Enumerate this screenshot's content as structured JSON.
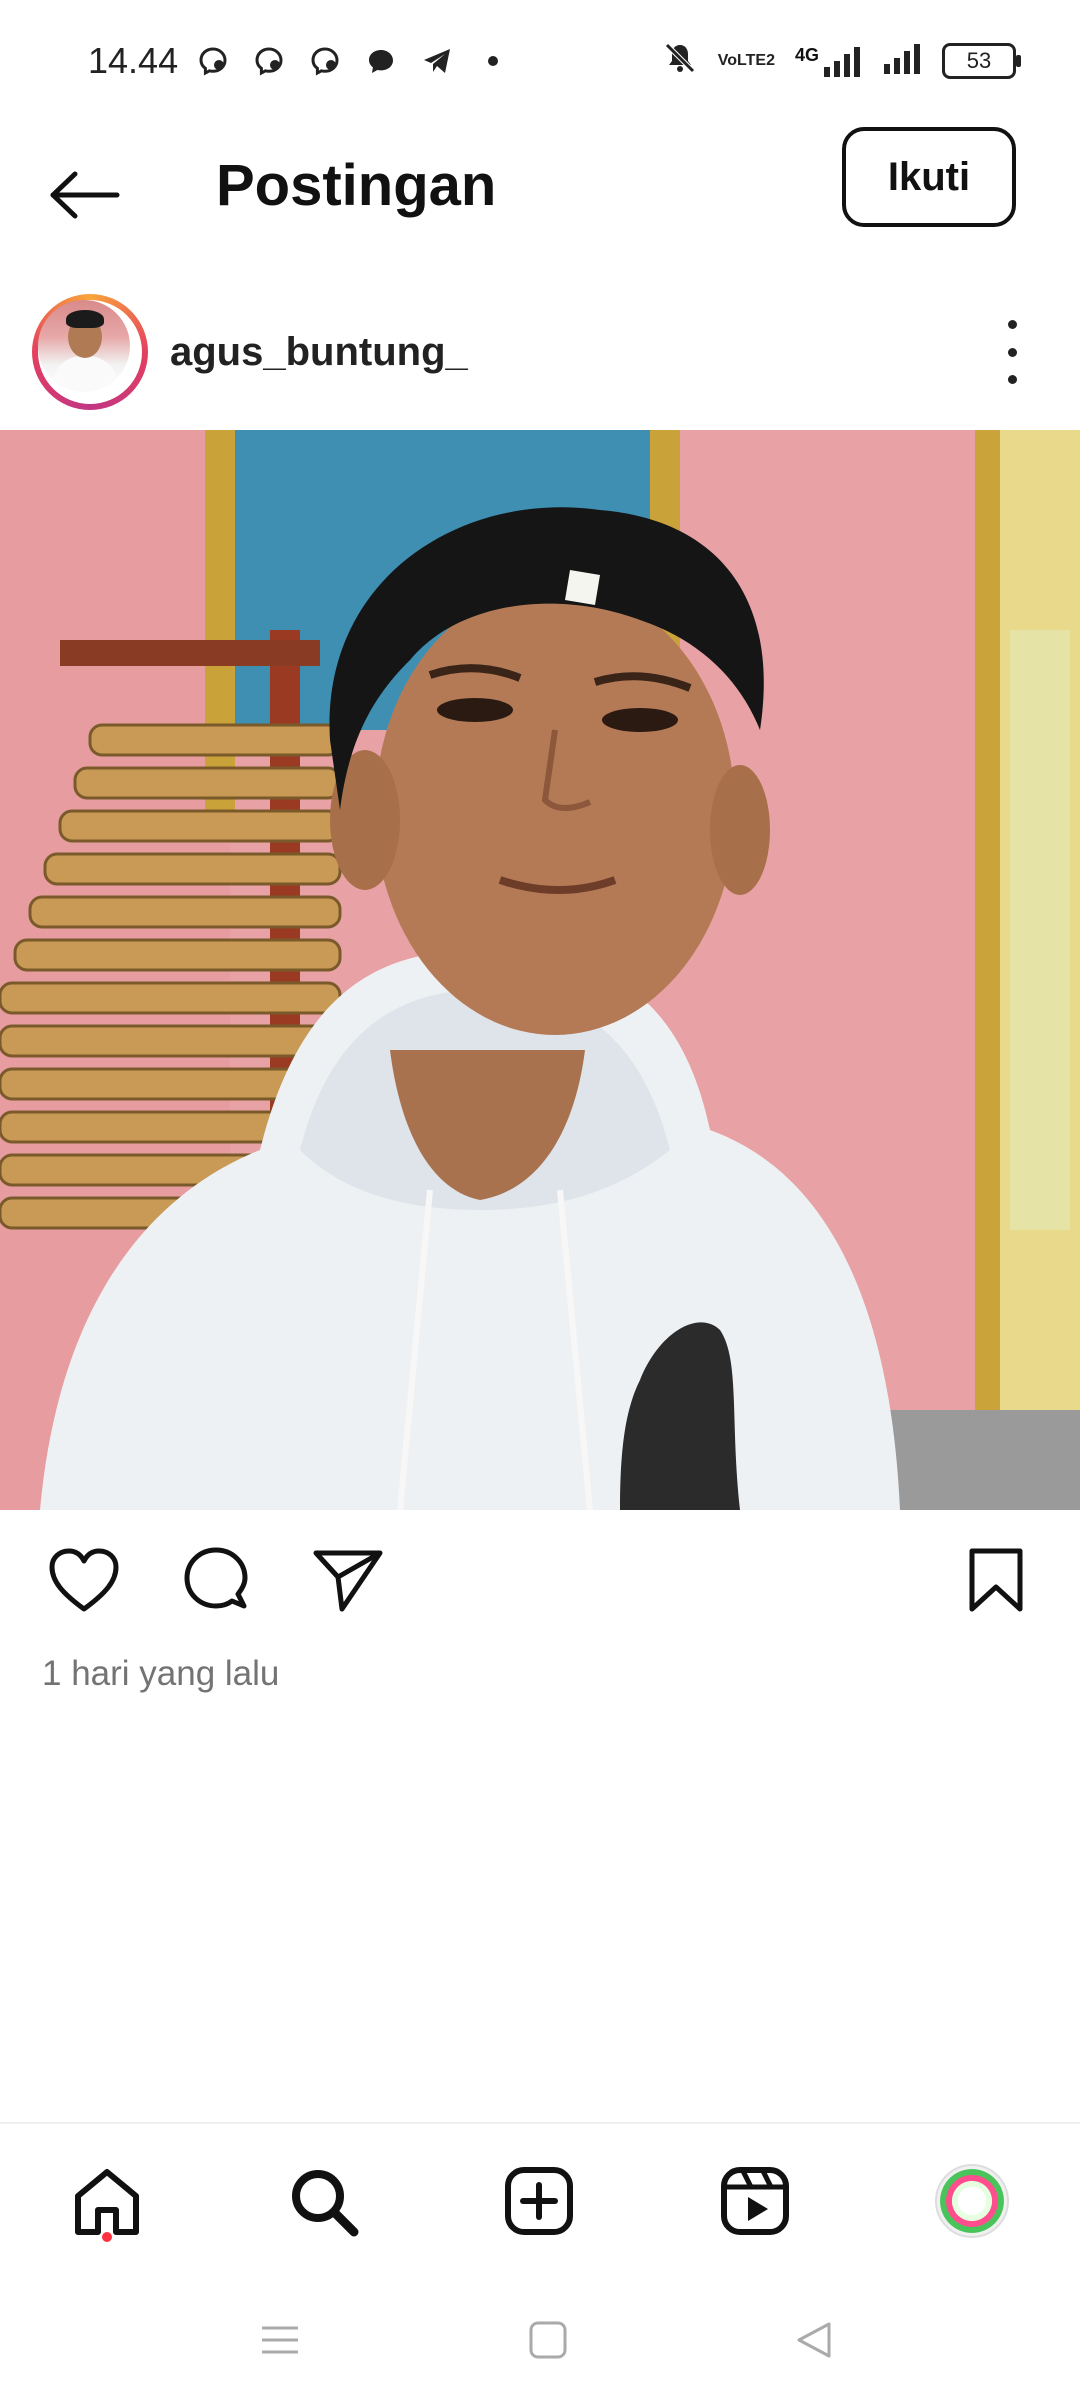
{
  "status_bar": {
    "time": "14.44",
    "battery_level": "53",
    "notification_icons": [
      "messenger-icon",
      "messenger-icon",
      "messenger-icon",
      "chat-bubble-icon",
      "telegram-icon",
      "dot-icon"
    ],
    "right_icons": [
      "mute-icon",
      "volte-icon",
      "signal-4g-icon",
      "signal-icon",
      "battery-icon"
    ],
    "network_label": "4G",
    "volte_label": "VoLTE2"
  },
  "header": {
    "title": "Postingan",
    "follow_label": "Ikuti"
  },
  "post": {
    "username": "agus_buntung_",
    "timestamp": "1 hari yang lalu"
  },
  "actions": {
    "icons": [
      "heart-icon",
      "comment-icon",
      "share-icon",
      "bookmark-icon"
    ]
  },
  "bottom_nav": {
    "items": [
      "home-icon",
      "search-icon",
      "create-icon",
      "reels-icon",
      "profile-avatar"
    ]
  },
  "system_nav": {
    "items": [
      "menu-icon",
      "home-square-icon",
      "back-triangle-icon"
    ]
  },
  "colors": {
    "accent_red": "#ff3040",
    "text_secondary": "#737373",
    "wall_pink": "#e9a3a6",
    "door_blue": "#3f8fb3"
  }
}
